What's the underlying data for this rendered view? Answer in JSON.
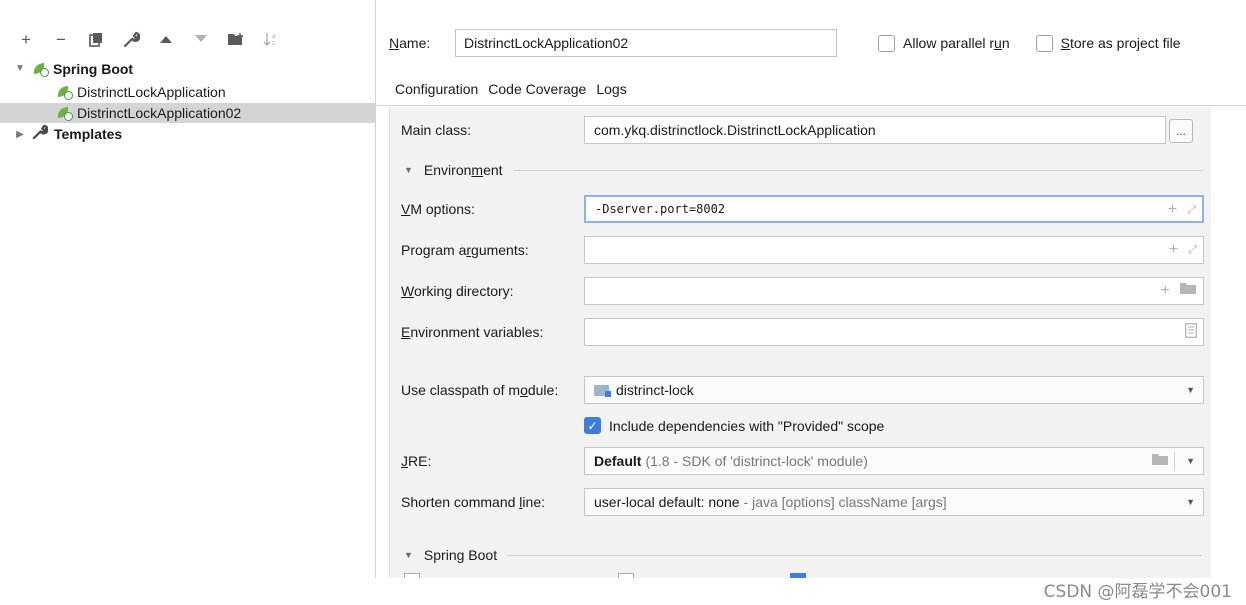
{
  "toolbar": {
    "icons": [
      "plus-icon",
      "minus-icon",
      "copy-icon",
      "wrench-icon",
      "arrow-up-icon",
      "arrow-down-icon",
      "folder-add-icon",
      "sort-icon"
    ]
  },
  "tree": {
    "items": [
      {
        "label": "Spring Boot",
        "bold": true,
        "expanded": true
      },
      {
        "label": "DistrinctLockApplication",
        "selected": false
      },
      {
        "label": "DistrinctLockApplication02",
        "selected": true
      },
      {
        "label": "Templates",
        "bold": true,
        "expanded": false
      }
    ]
  },
  "header": {
    "name_label": "ame:",
    "name_label_mnemonic": "N",
    "name_value": "DistrinctLockApplication02",
    "allow_parallel_pre": "Allow parallel r",
    "allow_parallel_mnemonic": "u",
    "allow_parallel_post": "n",
    "store_project_mnemonic": "S",
    "store_project_post": "tore as project file"
  },
  "tabs": [
    "Configuration",
    "Code Coverage",
    "Logs"
  ],
  "form": {
    "main_class_label": "Main class:",
    "main_class_value": "com.ykq.distrinctlock.DistrinctLockApplication",
    "browse_label": "...",
    "environment_pre": "Environ",
    "environment_mnemonic": "m",
    "environment_post": "ent",
    "vm_options_mnemonic": "V",
    "vm_options_post": "M options:",
    "vm_options_value": "-Dserver.port=8002",
    "program_args_pre": "Program a",
    "program_args_mnemonic": "r",
    "program_args_post": "guments:",
    "working_dir_mnemonic": "W",
    "working_dir_post": "orking directory:",
    "env_vars_mnemonic": "E",
    "env_vars_post": "nvironment variables:",
    "classpath_pre": "Use classpath of m",
    "classpath_mnemonic": "o",
    "classpath_post": "dule:",
    "classpath_value": "distrinct-lock",
    "include_deps_label": "Include dependencies with \"Provided\" scope",
    "jre_mnemonic": "J",
    "jre_post": "RE:",
    "jre_value_bold": "Default",
    "jre_value_grey": "(1.8 - SDK of 'distrinct-lock' module)",
    "shorten_pre": "Shorten command ",
    "shorten_mnemonic": "l",
    "shorten_post": "ine:",
    "shorten_value_main": "user-local default: none",
    "shorten_value_grey": "- java [options] className [args]",
    "spring_boot_pre": "Sprin",
    "spring_boot_mnemonic": "g",
    "spring_boot_post": " Boot"
  },
  "watermark": "CSDN @阿磊学不会001"
}
